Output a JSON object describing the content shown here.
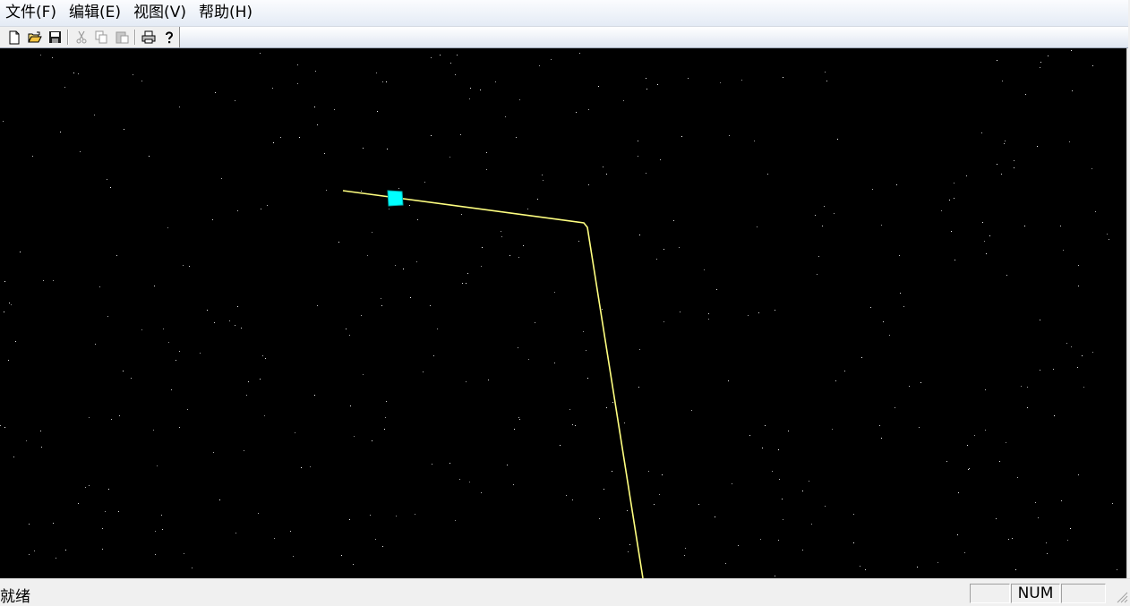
{
  "menu": {
    "items": [
      {
        "label": "文件(F)"
      },
      {
        "label": "编辑(E)"
      },
      {
        "label": "视图(V)"
      },
      {
        "label": "帮助(H)"
      }
    ]
  },
  "toolbar": {
    "buttons": [
      "new-file-icon",
      "open-folder-icon",
      "save-disk-icon",
      "cut-icon",
      "copy-icon",
      "paste-icon",
      "print-icon",
      "help-icon"
    ]
  },
  "scene": {
    "background_color": "#000000",
    "line_color": "#ffff80",
    "object_color": "#00ffff"
  },
  "status": {
    "text": "就绪",
    "panes": [
      "",
      "NUM",
      ""
    ]
  }
}
